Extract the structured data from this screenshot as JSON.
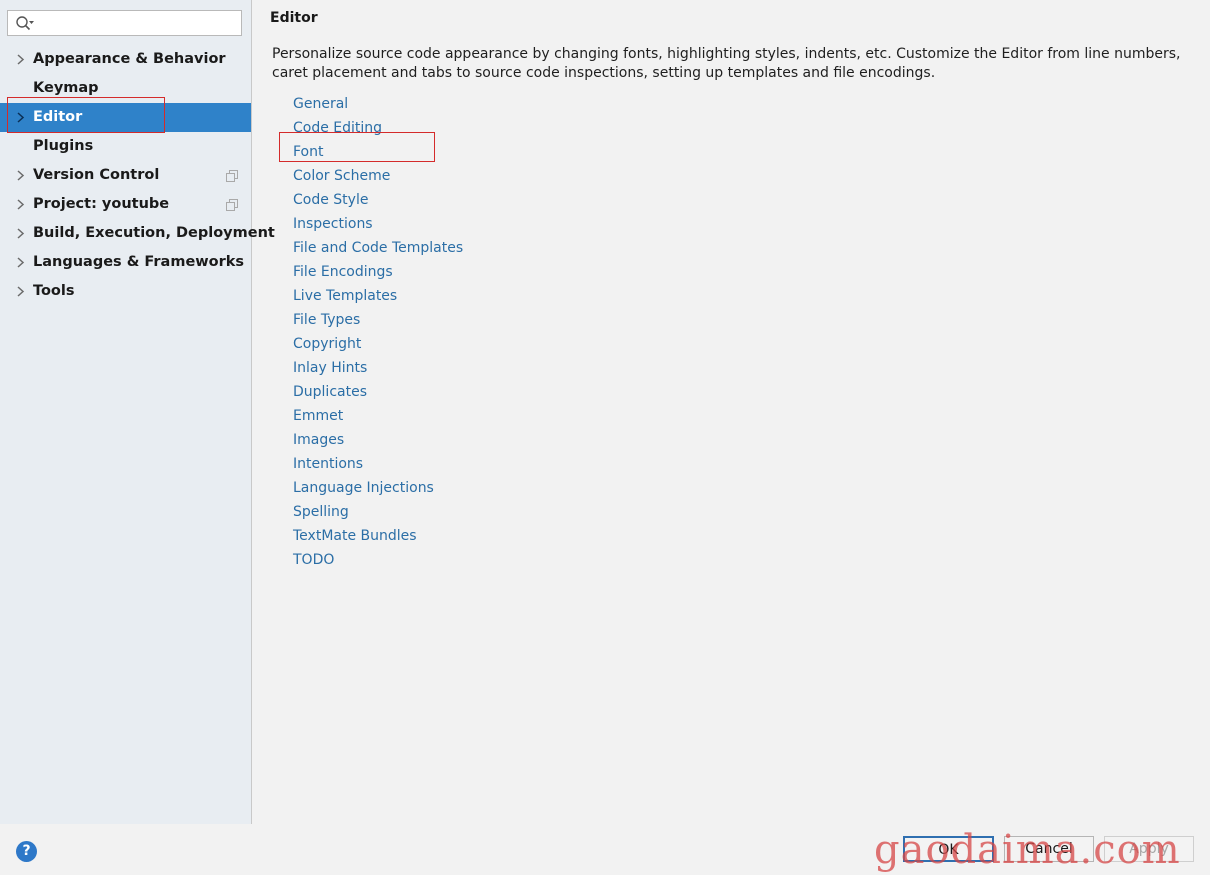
{
  "colors": {
    "selection": "#2f82c9",
    "link": "#2b6ea6",
    "annotation": "#d42b2b",
    "sidebar_bg": "#e8edf2",
    "main_bg": "#f2f2f2"
  },
  "search": {
    "placeholder": "",
    "value": "",
    "icon": "search-icon"
  },
  "sidebar": {
    "items": [
      {
        "label": "Appearance & Behavior",
        "expandable": true
      },
      {
        "label": "Keymap",
        "expandable": false
      },
      {
        "label": "Editor",
        "expandable": true,
        "selected": true
      },
      {
        "label": "Plugins",
        "expandable": false
      },
      {
        "label": "Version Control",
        "expandable": true,
        "project_icon": "copy-icon"
      },
      {
        "label": "Project: youtube",
        "expandable": true,
        "project_icon": "copy-icon"
      },
      {
        "label": "Build, Execution, Deployment",
        "expandable": true
      },
      {
        "label": "Languages & Frameworks",
        "expandable": true
      },
      {
        "label": "Tools",
        "expandable": true
      }
    ]
  },
  "main": {
    "title": "Editor",
    "description": "Personalize source code appearance by changing fonts, highlighting styles, indents, etc. Customize the Editor from line numbers, caret placement and tabs to source code inspections, setting up templates and file encodings.",
    "links": [
      "General",
      "Code Editing",
      "Font",
      "Color Scheme",
      "Code Style",
      "Inspections",
      "File and Code Templates",
      "File Encodings",
      "Live Templates",
      "File Types",
      "Copyright",
      "Inlay Hints",
      "Duplicates",
      "Emmet",
      "Images",
      "Intentions",
      "Language Injections",
      "Spelling",
      "TextMate Bundles",
      "TODO"
    ]
  },
  "footer": {
    "help_label": "?",
    "ok_label": "OK",
    "cancel_label": "Cancel",
    "apply_label": "Apply",
    "watermark": "gaodaima.com"
  }
}
